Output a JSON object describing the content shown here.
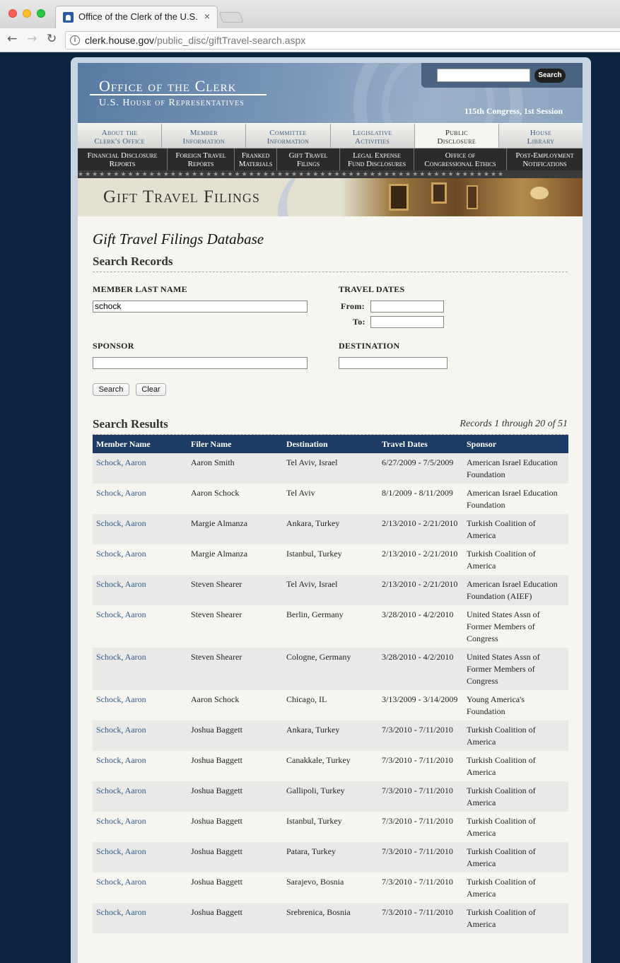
{
  "browser": {
    "tab_title": "Office of the Clerk of the U.S. H",
    "tab_close": "×",
    "url_host": "clerk.house.gov",
    "url_path": "/public_disc/giftTravel-search.aspx"
  },
  "header": {
    "title": "Office of the Clerk",
    "subtitle": "U.S. House of Representatives",
    "search_button": "Search",
    "session": "115th Congress, 1st Session"
  },
  "primary_nav": [
    {
      "line1": "About the",
      "line2": "Clerk's Office",
      "active": false
    },
    {
      "line1": "Member",
      "line2": "Information",
      "active": false
    },
    {
      "line1": "Committee",
      "line2": "Information",
      "active": false
    },
    {
      "line1": "Legislative",
      "line2": "Activities",
      "active": false
    },
    {
      "line1": "Public",
      "line2": "Disclosure",
      "active": true
    },
    {
      "line1": "House",
      "line2": "Library",
      "active": false
    }
  ],
  "secondary_nav": [
    {
      "line1": "Financial Disclosure",
      "line2": "Reports"
    },
    {
      "line1": "Foreign Travel",
      "line2": "Reports"
    },
    {
      "line1": "Franked",
      "line2": "Materials"
    },
    {
      "line1": "Gift Travel",
      "line2": "Filings"
    },
    {
      "line1": "Legal Expense",
      "line2": "Fund Disclosures"
    },
    {
      "line1": "Office of",
      "line2": "Congressional Ethics"
    },
    {
      "line1": "Post-Employment",
      "line2": "Notifications"
    }
  ],
  "stars": "★★★★★★★★★★★★★★★★★★★★★★★★★★★★★★★★★★★★★★★★★★★★★★★★★★★★★★★★★★★★",
  "banner_title": "Gift Travel Filings",
  "form": {
    "db_title": "Gift Travel Filings Database",
    "search_records": "Search Records",
    "member_label": "MEMBER LAST NAME",
    "member_value": "schock",
    "travel_dates_label": "TRAVEL DATES",
    "from_label": "From:",
    "from_value": "",
    "to_label": "To:",
    "to_value": "",
    "sponsor_label": "SPONSOR",
    "sponsor_value": "",
    "destination_label": "DESTINATION",
    "destination_value": "",
    "search_button": "Search",
    "clear_button": "Clear"
  },
  "results": {
    "title": "Search Results",
    "records": "Records 1 through 20 of 51",
    "columns": [
      "Member Name",
      "Filer Name",
      "Destination",
      "Travel Dates",
      "Sponsor"
    ],
    "rows": [
      {
        "member": "Schock, Aaron",
        "filer": "Aaron Smith",
        "destination": "Tel Aviv, Israel",
        "dates": "6/27/2009 - 7/5/2009",
        "sponsor": "American Israel Education Foundation"
      },
      {
        "member": "Schock, Aaron",
        "filer": "Aaron Schock",
        "destination": "Tel Aviv",
        "dates": "8/1/2009 - 8/11/2009",
        "sponsor": "American Israel Education Foundation"
      },
      {
        "member": "Schock, Aaron",
        "filer": "Margie Almanza",
        "destination": "Ankara, Turkey",
        "dates": "2/13/2010 - 2/21/2010",
        "sponsor": "Turkish Coalition of America"
      },
      {
        "member": "Schock, Aaron",
        "filer": "Margie Almanza",
        "destination": "Istanbul, Turkey",
        "dates": "2/13/2010 - 2/21/2010",
        "sponsor": "Turkish Coalition of America"
      },
      {
        "member": "Schock, Aaron",
        "filer": "Steven Shearer",
        "destination": "Tel Aviv, Israel",
        "dates": "2/13/2010 - 2/21/2010",
        "sponsor": "American Israel Education Foundation (AIEF)"
      },
      {
        "member": "Schock, Aaron",
        "filer": "Steven Shearer",
        "destination": "Berlin, Germany",
        "dates": "3/28/2010 - 4/2/2010",
        "sponsor": "United States Assn of Former Members of Congress"
      },
      {
        "member": "Schock, Aaron",
        "filer": "Steven Shearer",
        "destination": "Cologne, Germany",
        "dates": "3/28/2010 - 4/2/2010",
        "sponsor": "United States Assn of Former Members of Congress"
      },
      {
        "member": "Schock, Aaron",
        "filer": "Aaron Schock",
        "destination": "Chicago, IL",
        "dates": "3/13/2009 - 3/14/2009",
        "sponsor": "Young America's Foundation"
      },
      {
        "member": "Schock, Aaron",
        "filer": "Joshua Baggett",
        "destination": "Ankara, Turkey",
        "dates": "7/3/2010 - 7/11/2010",
        "sponsor": "Turkish Coalition of America"
      },
      {
        "member": "Schock, Aaron",
        "filer": "Joshua Baggett",
        "destination": "Canakkale, Turkey",
        "dates": "7/3/2010 - 7/11/2010",
        "sponsor": "Turkish Coalition of America"
      },
      {
        "member": "Schock, Aaron",
        "filer": "Joshua Baggett",
        "destination": "Gallipoli, Turkey",
        "dates": "7/3/2010 - 7/11/2010",
        "sponsor": "Turkish Coalition of America"
      },
      {
        "member": "Schock, Aaron",
        "filer": "Joshua Baggett",
        "destination": "Istanbul, Turkey",
        "dates": "7/3/2010 - 7/11/2010",
        "sponsor": "Turkish Coalition of America"
      },
      {
        "member": "Schock, Aaron",
        "filer": "Joshua Baggett",
        "destination": "Patara, Turkey",
        "dates": "7/3/2010 - 7/11/2010",
        "sponsor": "Turkish Coalition of America"
      },
      {
        "member": "Schock, Aaron",
        "filer": "Joshua Baggett",
        "destination": "Sarajevo, Bosnia",
        "dates": "7/3/2010 - 7/11/2010",
        "sponsor": "Turkish Coalition of America"
      },
      {
        "member": "Schock, Aaron",
        "filer": "Joshua Baggett",
        "destination": "Srebrenica, Bosnia",
        "dates": "7/3/2010 - 7/11/2010",
        "sponsor": "Turkish Coalition of America"
      }
    ]
  }
}
